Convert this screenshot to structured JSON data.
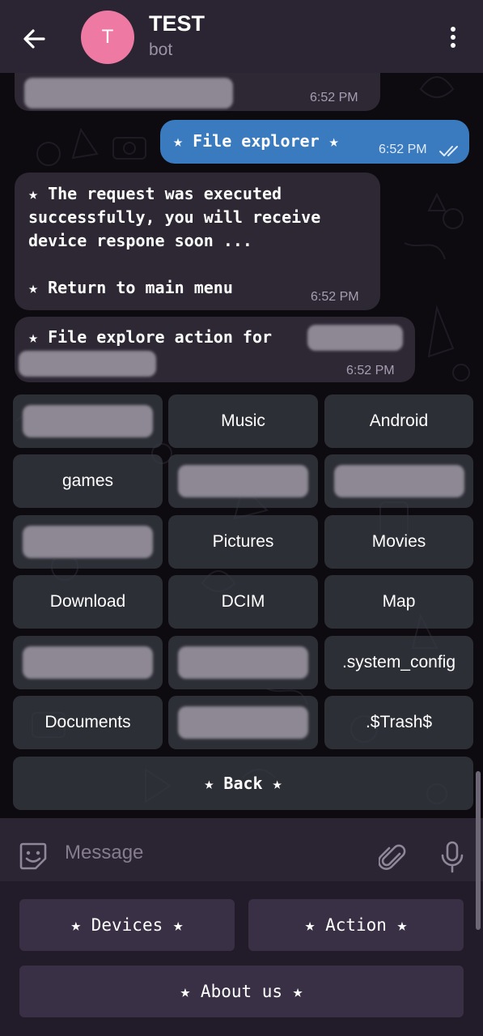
{
  "header": {
    "title": "TEST",
    "subtitle": "bot",
    "avatar_letter": "T",
    "avatar_color": "#ee7aa3"
  },
  "messages": [
    {
      "type": "incoming",
      "text": "",
      "time": "6:52 PM",
      "note": "partially scrolled, content redacted"
    },
    {
      "type": "outgoing",
      "text": "★ File explorer ★",
      "time": "6:52 PM",
      "status": "read"
    },
    {
      "type": "incoming",
      "text": "★ The request was executed\nsuccessfully, you will receive\ndevice respone soon ...\n\n★ Return to main menu",
      "time": "6:52 PM"
    },
    {
      "type": "incoming",
      "text": "★ File explore action for",
      "time": "6:52 PM"
    }
  ],
  "inline_keyboard": [
    [
      "",
      "Music",
      "Android"
    ],
    [
      "games",
      "",
      ""
    ],
    [
      "",
      "Pictures",
      "Movies"
    ],
    [
      "Download",
      "DCIM",
      "Map"
    ],
    [
      "",
      "",
      ".system_config"
    ],
    [
      "Documents",
      "",
      ".$Trash$"
    ],
    [
      "★ Back ★"
    ]
  ],
  "input": {
    "placeholder": "Message",
    "value": ""
  },
  "reply_keyboard": {
    "devices": "★ Devices ★",
    "action": "★ Action ★",
    "about": "★ About us ★"
  },
  "icons": [
    "back-arrow-icon",
    "more-vert-icon",
    "sticker-icon",
    "paperclip-icon",
    "microphone-icon",
    "double-check-icon"
  ],
  "colors": {
    "header_bg": "#2b2533",
    "incoming_bubble": "#2e2835",
    "outgoing_bubble": "#3a7bc0",
    "inline_button": "#373a42",
    "reply_button": "#3a3045"
  }
}
